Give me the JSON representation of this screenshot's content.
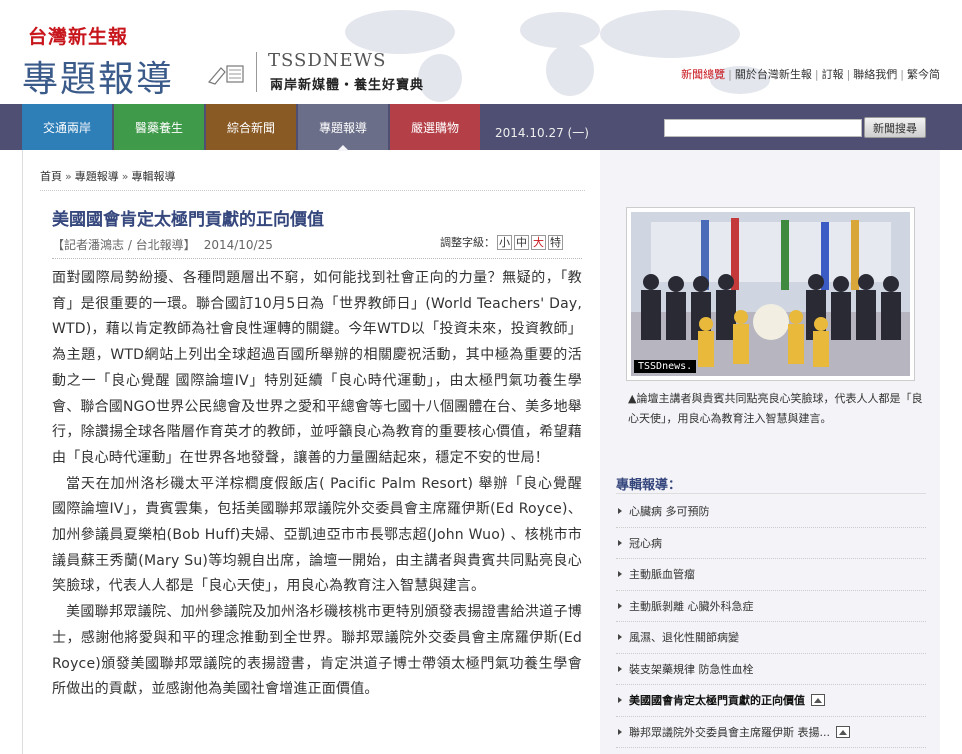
{
  "header": {
    "logo_top": "台灣新生報",
    "logo_big": "專題報導",
    "brand_en": "TSSDNEWS",
    "brand_zh": "兩岸新媒體・養生好寶典",
    "links": [
      "新聞總覽",
      "關於台灣新生報",
      "訂報",
      "聯絡我們",
      "繁今简"
    ]
  },
  "nav": {
    "tabs": [
      "交通兩岸",
      "醫藥養生",
      "綜合新聞",
      "專題報導",
      "嚴選購物"
    ],
    "active_tab": "專題報導",
    "date": "2014.10.27 (一)",
    "search_value": "",
    "search_button": "新聞搜尋"
  },
  "breadcrumb": [
    "首頁",
    "專題報導",
    "專輯報導"
  ],
  "article": {
    "title": "美國國會肯定太極門貢獻的正向價值",
    "byline": "【記者潘鴻志 / 台北報導】",
    "date": "2014/10/25",
    "fontsize_label": "調整字級：",
    "fontsize_options": [
      "小",
      "中",
      "大",
      "特"
    ],
    "paragraphs": [
      "面對國際局勢紛擾、各種問題層出不窮，如何能找到社會正向的力量？無疑的，「教育」是很重要的一環。聯合國訂10月5日為「世界教師日」(World Teachers' Day, WTD)，藉以肯定教師為社會良性運轉的關鍵。今年WTD以「投資未來，投資教師」為主題，WTD網站上列出全球超過百國所舉辦的相關慶祝活動，其中極為重要的活動之一「良心覺醒 國際論壇IV」特別延續「良心時代運動」，由太極門氣功養生學會、聯合國NGO世界公民總會及世界之愛和平總會等七國十八個團體在台、美多地舉行，除讚揚全球各階層作育英才的教師，並呼籲良心為教育的重要核心價值，希望藉由「良心時代運動」在世界各地發聲，讓善的力量團結起來，穩定不安的世局！",
      "當天在加州洛杉磯太平洋棕櫚度假飯店( Pacific Palm Resort) 舉辦「良心覺醒 國際論壇IV」，貴賓雲集，包括美國聯邦眾議院外交委員會主席羅伊斯(Ed Royce)、加州參議員夏樂柏(Bob Huff)夫婦、亞凱迪亞市市長鄂志超(John Wuo) 、核桃市市議員蘇王秀蘭(Mary Su)等均親自出席，論壇一開始，由主講者與貴賓共同點亮良心笑臉球，代表人人都是「良心天使」，用良心為教育注入智慧與建言。",
      "美國聯邦眾議院、加州參議院及加州洛杉磯核桃市更特別頒發表揚證書給洪道子博士，感謝他將愛與和平的理念推動到全世界。聯邦眾議院外交委員會主席羅伊斯(Ed Royce)頒發美國聯邦眾議院的表揚證書，肯定洪道子博士帶領太極門氣功養生學會所做出的貢獻，並感謝他為美國社會增進正面價值。"
    ]
  },
  "photo": {
    "tag": "TSSDnews.",
    "caption": "▲論壇主講者與貴賓共同點亮良心笑臉球，代表人人都是「良心天使」，用良心為教育注入智慧與建言。"
  },
  "sidebar": {
    "title": "專輯報導：",
    "items": [
      {
        "label": "心臟病 多可預防",
        "has_image": false,
        "current": false
      },
      {
        "label": "冠心病",
        "has_image": false,
        "current": false
      },
      {
        "label": "主動脈血管瘤",
        "has_image": false,
        "current": false
      },
      {
        "label": "主動脈剝離 心臟外科急症",
        "has_image": false,
        "current": false
      },
      {
        "label": "風濕、退化性關節病變",
        "has_image": false,
        "current": false
      },
      {
        "label": "裝支架藥規律 防急性血栓",
        "has_image": false,
        "current": false
      },
      {
        "label": "美國國會肯定太極門貢獻的正向價值",
        "has_image": true,
        "current": true
      },
      {
        "label": "聯邦眾議院外交委員會主席羅伊斯 表揚...",
        "has_image": true,
        "current": false
      }
    ]
  },
  "colors": {
    "brand_red": "#c8161d",
    "title_blue": "#35477d",
    "nav_bg": "#4e4f73"
  }
}
